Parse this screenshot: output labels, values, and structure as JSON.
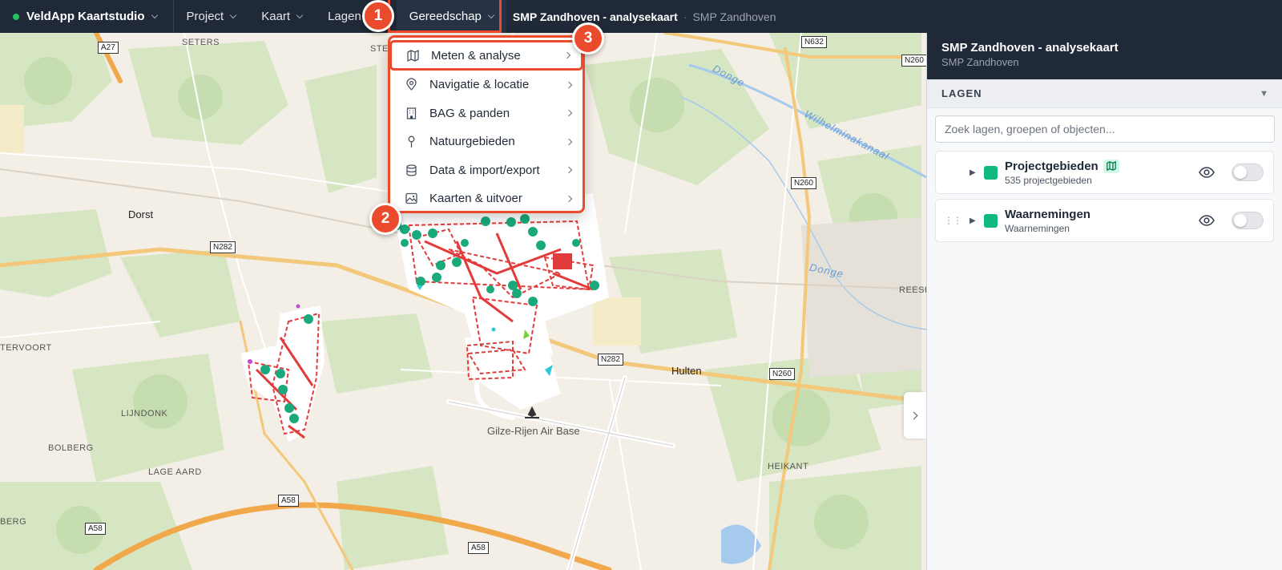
{
  "topbar": {
    "app_name": "VeldApp Kaartstudio",
    "menus": [
      "Project",
      "Kaart",
      "Lagen",
      "Gereedschap"
    ],
    "breadcrumb_main": "SMP Zandhoven - analysekaart",
    "breadcrumb_sep": "·",
    "breadcrumb_sub": "SMP Zandhoven"
  },
  "dropdown": {
    "items": [
      {
        "label": "Meten & analyse",
        "icon": "map-icon"
      },
      {
        "label": "Navigatie & locatie",
        "icon": "location-pin-icon"
      },
      {
        "label": "BAG & panden",
        "icon": "building-icon"
      },
      {
        "label": "Natuurgebieden",
        "icon": "pin-icon"
      },
      {
        "label": "Data & import/export",
        "icon": "database-icon"
      },
      {
        "label": "Kaarten & uitvoer",
        "icon": "image-icon"
      }
    ]
  },
  "markers": [
    "1",
    "2",
    "3"
  ],
  "map": {
    "labels": {
      "seters": "SETERS",
      "dorst": "Dorst",
      "tervoort": "TERVOORT",
      "lijndonk": "LIJNDONK",
      "bolberg": "BOLBERG",
      "lage_aard": "LAGE AARD",
      "berg": "BERG",
      "hulten": "Hulten",
      "heikant": "HEIKANT",
      "reesh": "REESH",
      "airbase": "Gilze-Rijen Air Base",
      "donge1": "Donge",
      "donge2": "Donge",
      "wilhelmina": "Wilhelminakanaal",
      "ste": "STE"
    },
    "shields": {
      "a27": "A27",
      "n632": "N632",
      "n260a": "N260",
      "n260b": "N260",
      "n260c": "N260",
      "n282a": "N282",
      "n282b": "N282",
      "a58a": "A58",
      "a58b": "A58",
      "a58c": "A58"
    }
  },
  "panel": {
    "title": "SMP Zandhoven - analysekaart",
    "subtitle": "SMP Zandhoven",
    "section_label": "LAGEN",
    "section_caret": "▼",
    "search_placeholder": "Zoek lagen, groepen of objecten...",
    "layers": [
      {
        "name": "Projectgebieden",
        "meta": "535 projectgebieden",
        "color": "#10b981",
        "visible": false
      },
      {
        "name": "Waarnemingen",
        "meta": "Waarnemingen",
        "color": "#10b981",
        "visible": false
      }
    ],
    "expand_glyph": "▶",
    "drag_glyph": "⋮⋮"
  }
}
